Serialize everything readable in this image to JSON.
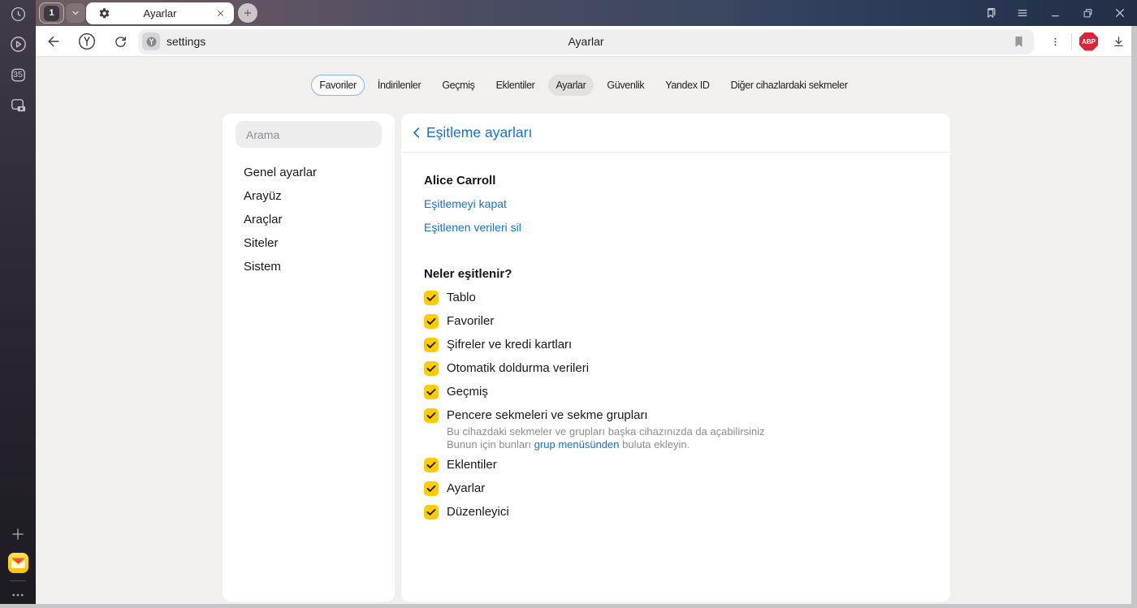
{
  "tabbar": {
    "tab_counter": "1",
    "tab_title": "Ayarlar"
  },
  "toolbar": {
    "url_text": "settings",
    "page_title": "Ayarlar",
    "adblock_badge": "ABP"
  },
  "side_rail": {
    "tab_badge": "35"
  },
  "nav": {
    "pills": [
      {
        "label": "Favoriler",
        "variant": "outlined"
      },
      {
        "label": "İndirilenler",
        "variant": "plain"
      },
      {
        "label": "Geçmiş",
        "variant": "plain"
      },
      {
        "label": "Eklentiler",
        "variant": "plain"
      },
      {
        "label": "Ayarlar",
        "variant": "active"
      },
      {
        "label": "Güvenlik",
        "variant": "plain"
      },
      {
        "label": "Yandex ID",
        "variant": "plain"
      },
      {
        "label": "Diğer cihazlardaki sekmeler",
        "variant": "plain"
      }
    ]
  },
  "settings_menu": {
    "search_placeholder": "Arama",
    "items": [
      "Genel ayarlar",
      "Arayüz",
      "Araçlar",
      "Siteler",
      "Sistem"
    ]
  },
  "sync": {
    "title": "Eşitleme ayarları",
    "account_name": "Alice Carroll",
    "action_links": [
      "Eşitlemeyi kapat",
      "Eşitlenen verileri sil"
    ],
    "section_heading": "Neler eşitlenir?",
    "items": [
      {
        "label": "Tablo",
        "checked": true
      },
      {
        "label": "Favoriler",
        "checked": true
      },
      {
        "label": "Şifreler ve kredi kartları",
        "checked": true
      },
      {
        "label": "Otomatik doldurma verileri",
        "checked": true
      },
      {
        "label": "Geçmiş",
        "checked": true
      },
      {
        "label": "Pencere sekmeleri ve sekme grupları",
        "checked": true,
        "description": {
          "line1": "Bu cihazdaki sekmeler ve grupları başka cihazınızda da açabilirsiniz",
          "line2_prefix": "Bunun için bunları ",
          "line2_link": "grup menüsünden",
          "line2_suffix": " buluta ekleyin."
        }
      },
      {
        "label": "Eklentiler",
        "checked": true
      },
      {
        "label": "Ayarlar",
        "checked": true
      },
      {
        "label": "Düzenleyici",
        "checked": true
      }
    ]
  },
  "colors": {
    "accent_blue": "#1571d8",
    "checkbox_yellow": "#ffcc00",
    "adblock_red": "#dd2338"
  }
}
